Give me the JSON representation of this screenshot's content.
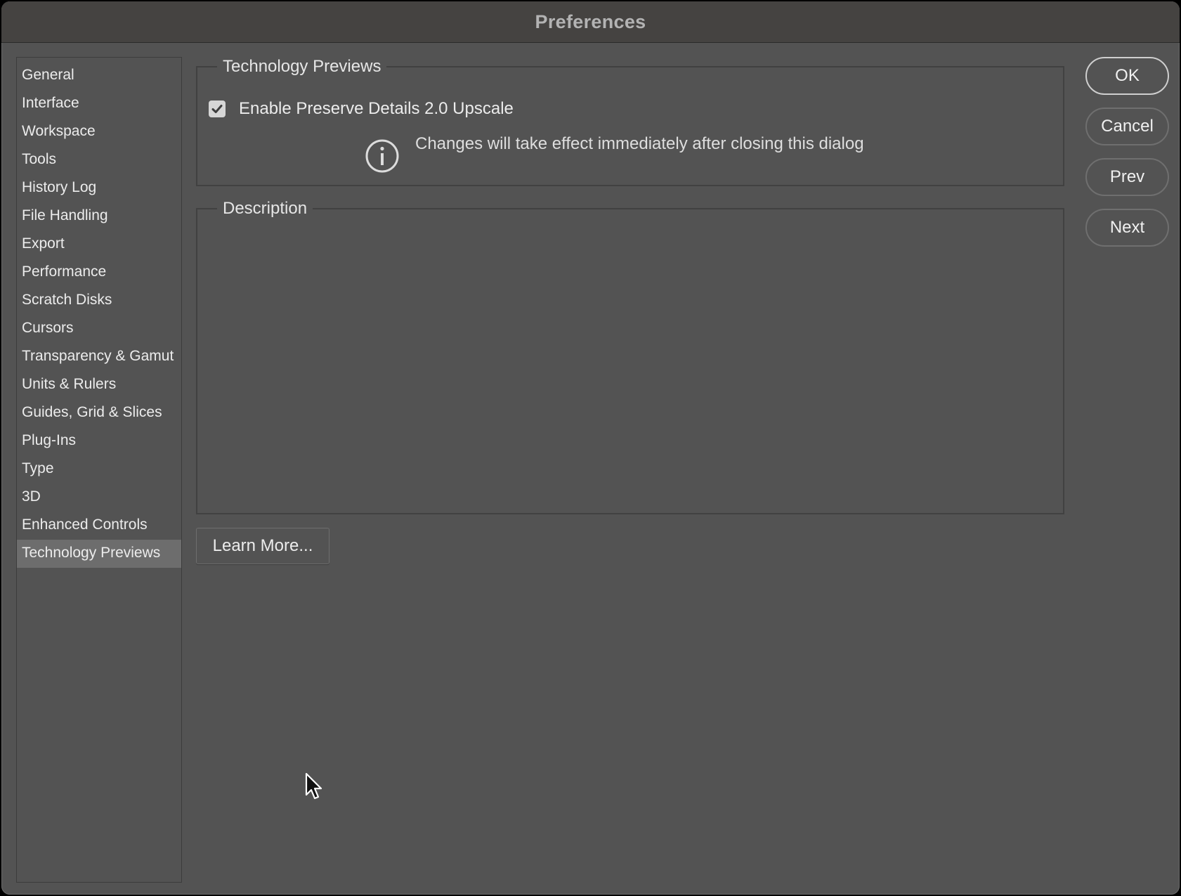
{
  "window": {
    "title": "Preferences"
  },
  "sidebar": {
    "items": [
      {
        "label": "General",
        "selected": false
      },
      {
        "label": "Interface",
        "selected": false
      },
      {
        "label": "Workspace",
        "selected": false
      },
      {
        "label": "Tools",
        "selected": false
      },
      {
        "label": "History Log",
        "selected": false
      },
      {
        "label": "File Handling",
        "selected": false
      },
      {
        "label": "Export",
        "selected": false
      },
      {
        "label": "Performance",
        "selected": false
      },
      {
        "label": "Scratch Disks",
        "selected": false
      },
      {
        "label": "Cursors",
        "selected": false
      },
      {
        "label": "Transparency & Gamut",
        "selected": false
      },
      {
        "label": "Units & Rulers",
        "selected": false
      },
      {
        "label": "Guides, Grid & Slices",
        "selected": false
      },
      {
        "label": "Plug-Ins",
        "selected": false
      },
      {
        "label": "Type",
        "selected": false
      },
      {
        "label": "3D",
        "selected": false
      },
      {
        "label": "Enhanced Controls",
        "selected": false
      },
      {
        "label": "Technology Previews",
        "selected": true
      }
    ]
  },
  "technology_previews": {
    "legend": "Technology Previews",
    "checkbox_label": "Enable Preserve Details 2.0 Upscale",
    "checkbox_checked": true,
    "info_icon": "info-icon",
    "info_text": "Changes will take effect immediately after closing this dialog"
  },
  "description": {
    "legend": "Description",
    "text": ""
  },
  "learn_more_label": "Learn More...",
  "buttons": {
    "ok": "OK",
    "cancel": "Cancel",
    "prev": "Prev",
    "next": "Next"
  },
  "colors": {
    "background": "#535353",
    "titlebar": "#454341",
    "selected_item": "#6d6d6d",
    "text": "#ececec"
  }
}
